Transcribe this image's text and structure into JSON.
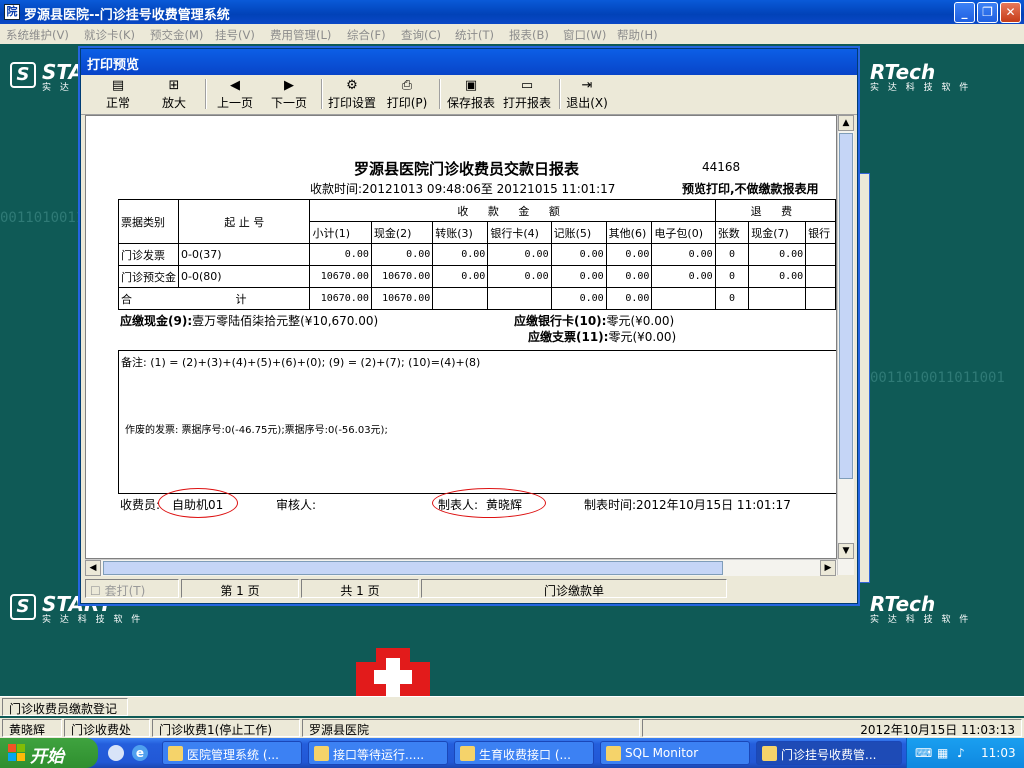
{
  "app": {
    "title": "罗源县医院--门诊挂号收费管理系统",
    "icon_name": "hospital-app-icon"
  },
  "menu": [
    "系统维护(V)",
    "就诊卡(K)",
    "预交金(M)",
    "挂号(V)",
    "费用管理(L)",
    "综合(F)",
    "查询(C)",
    "统计(T)",
    "报表(B)",
    "窗口(W)",
    "帮助(H)"
  ],
  "desktop": {
    "brand_left": "START",
    "brand_right": "RTech",
    "brand_sub": "实 达 科 技 软 件",
    "binary": "0011010011011001"
  },
  "dialog": {
    "title": "打印预览",
    "toolbar": [
      {
        "label": "正常",
        "icon": "page-icon"
      },
      {
        "label": "放大",
        "icon": "zoom-icon"
      },
      {
        "label": "上一页",
        "icon": "left-arrow-icon"
      },
      {
        "label": "下一页",
        "icon": "right-arrow-icon"
      },
      {
        "label": "打印设置",
        "icon": "print-setup-icon"
      },
      {
        "label": "打印(P)",
        "icon": "printer-icon"
      },
      {
        "label": "保存报表",
        "icon": "save-icon"
      },
      {
        "label": "打开报表",
        "icon": "open-folder-icon"
      },
      {
        "label": "退出(X)",
        "icon": "exit-icon"
      }
    ],
    "status": {
      "checkbox": "套打(T)",
      "page": "第 1 页",
      "total": "共 1 页",
      "doc": "门诊缴款单"
    }
  },
  "report": {
    "title": "罗源县医院门诊收费员交款日报表",
    "number": "44168",
    "time_range": "收款时间:20121013 09:48:06至 20121015 11:01:17",
    "preview_note": "预览打印,不做缴款报表用",
    "headers": {
      "type": "票据类别",
      "range": "起 止 号",
      "income": "收 款 金 额",
      "refund": "退 费",
      "cols": [
        "小计(1)",
        "现金(2)",
        "转账(3)",
        "银行卡(4)",
        "记账(5)",
        "其他(6)",
        "电子包(0)",
        "张数",
        "现金(7)",
        "银行"
      ]
    },
    "rows": [
      {
        "type": "门诊发票",
        "range": "0-0(37)",
        "vals": [
          "0.00",
          "0.00",
          "0.00",
          "0.00",
          "0.00",
          "0.00",
          "0.00",
          "0",
          "0.00"
        ]
      },
      {
        "type": "门诊预交金",
        "range": "0-0(80)",
        "vals": [
          "10670.00",
          "10670.00",
          "0.00",
          "0.00",
          "0.00",
          "0.00",
          "0.00",
          "0",
          "0.00"
        ]
      }
    ],
    "total": {
      "label": "合 计",
      "vals": [
        "10670.00",
        "10670.00",
        "",
        "",
        "0.00",
        "0.00",
        "",
        "0",
        ""
      ]
    },
    "cash_label": "应缴现金(9):",
    "cash_value": "壹万零陆佰柒拾元整(¥10,670.00)",
    "bank_label": "应缴银行卡(10):",
    "bank_value": "零元(¥0.00)",
    "check_label": "应缴支票(11):",
    "check_value": "零元(¥0.00)",
    "note": "备注: (1) = (2)+(3)+(4)+(5)+(6)+(0); (9) = (2)+(7); (10)=(4)+(8)",
    "void": "作废的发票: 票据序号:0(-46.75元);票据序号:0(-56.03元);",
    "cashier_label": "收费员:",
    "cashier": "自助机01",
    "reviewer": "审核人:",
    "maker_label": "制表人:",
    "maker": "黄晓辉",
    "made_time": "制表时间:2012年10月15日 11:01:17"
  },
  "bottom": {
    "tab": "门诊收费员缴款登记",
    "user": "黄晓辉",
    "dept": "门诊收费处",
    "station": "门诊收费1(停止工作)",
    "hospital": "罗源县医院",
    "datetime": "2012年10月15日 11:03:13"
  },
  "taskbar": {
    "start": "开始",
    "tasks": [
      "医院管理系统 (...",
      "接口等待运行.....",
      "生育收费接口 (...",
      "SQL Monitor",
      "门诊挂号收费管..."
    ],
    "clock": "11:03"
  }
}
